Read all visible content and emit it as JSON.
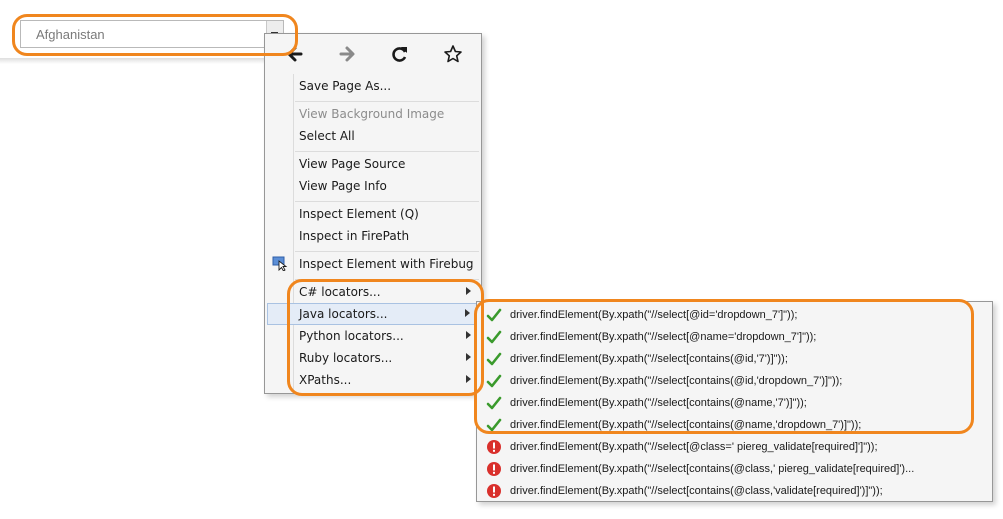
{
  "select": {
    "value": "Afghanistan"
  },
  "menu": {
    "nav": {
      "back": "back-arrow-icon",
      "forward": "forward-arrow-icon",
      "reload": "reload-icon",
      "bookmark": "star-icon"
    },
    "items": [
      {
        "label": "Save Page As..."
      },
      {
        "label": "View Background Image"
      },
      {
        "label": "Select All"
      },
      {
        "label": "View Page Source"
      },
      {
        "label": "View Page Info"
      },
      {
        "label": "Inspect Element (Q)"
      },
      {
        "label": "Inspect in FirePath"
      },
      {
        "label": "Inspect Element with Firebug"
      },
      {
        "label": "C# locators..."
      },
      {
        "label": "Java locators..."
      },
      {
        "label": "Python locators..."
      },
      {
        "label": "Ruby locators..."
      },
      {
        "label": "XPaths..."
      }
    ]
  },
  "submenu": {
    "items": [
      {
        "text": "driver.findElement(By.xpath(\"//select[@id='dropdown_7']\"));",
        "status": "valid"
      },
      {
        "text": "driver.findElement(By.xpath(\"//select[@name='dropdown_7']\"));",
        "status": "valid"
      },
      {
        "text": "driver.findElement(By.xpath(\"//select[contains(@id,'7')]\"));",
        "status": "valid"
      },
      {
        "text": "driver.findElement(By.xpath(\"//select[contains(@id,'dropdown_7')]\"));",
        "status": "valid"
      },
      {
        "text": "driver.findElement(By.xpath(\"//select[contains(@name,'7')]\"));",
        "status": "valid"
      },
      {
        "text": "driver.findElement(By.xpath(\"//select[contains(@name,'dropdown_7')]\"));",
        "status": "valid"
      },
      {
        "text": "driver.findElement(By.xpath(\"//select[@class='  piereg_validate[required]']\"));",
        "status": "error"
      },
      {
        "text": "driver.findElement(By.xpath(\"//select[contains(@class,'  piereg_validate[required]')...",
        "status": "error"
      },
      {
        "text": "driver.findElement(By.xpath(\"//select[contains(@class,'validate[required]')]\"));",
        "status": "error"
      }
    ]
  },
  "colors": {
    "highlight": "#f0861e",
    "check": "#3a9a2c",
    "error": "#d9302c"
  }
}
